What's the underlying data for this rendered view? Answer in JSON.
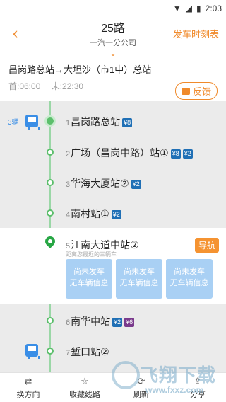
{
  "statusbar": {
    "time": "2:03"
  },
  "header": {
    "title": "25路",
    "subtitle": "一汽一分公司",
    "schedule_link": "发车时刻表"
  },
  "route": {
    "direction": "昌岗路总站→大坦沙（市1中）总站",
    "first": "首:06:00",
    "last": "末:22:30",
    "feedback": "反馈"
  },
  "bus_count": "3辆",
  "stops": [
    {
      "num": "1",
      "name": "昌岗路总站",
      "tags": [
        {
          "text": "¥8",
          "color": "blue"
        }
      ]
    },
    {
      "num": "2",
      "name": "广场（昌岗中路）站①",
      "tags": [
        {
          "text": "¥8",
          "color": "blue"
        },
        {
          "text": "¥2",
          "color": "blue"
        }
      ]
    },
    {
      "num": "3",
      "name": "华海大厦站②",
      "tags": [
        {
          "text": "¥2",
          "color": "blue"
        }
      ]
    },
    {
      "num": "4",
      "name": "南村站①",
      "tags": [
        {
          "text": "¥2",
          "color": "blue"
        }
      ]
    },
    {
      "num": "6",
      "name": "南华中站",
      "tags": [
        {
          "text": "¥2",
          "color": "blue"
        },
        {
          "text": "¥6",
          "color": "purple"
        }
      ]
    },
    {
      "num": "7",
      "name": "堑口站②",
      "tags": []
    }
  ],
  "current_stop": {
    "num": "5",
    "name": "江南大道中站②",
    "hint": "距离您最近的三辆车",
    "nav_label": "导航",
    "cards": [
      {
        "line1": "尚未发车",
        "line2": "无车辆信息"
      },
      {
        "line1": "尚未发车",
        "line2": "无车辆信息"
      },
      {
        "line1": "尚未发车",
        "line2": "无车辆信息"
      }
    ]
  },
  "tabs": [
    {
      "label": "换方向",
      "icon": "swap-icon"
    },
    {
      "label": "收藏线路",
      "icon": "star-icon"
    },
    {
      "label": "刷新",
      "icon": "refresh-icon"
    },
    {
      "label": "分享",
      "icon": "share-icon"
    }
  ],
  "watermark": {
    "text": "飞翔下载",
    "url": "www.fxxz.com"
  },
  "colors": {
    "accent": "#f08a2b",
    "line": "#5cbf6c",
    "bus": "#3a8ee6"
  }
}
